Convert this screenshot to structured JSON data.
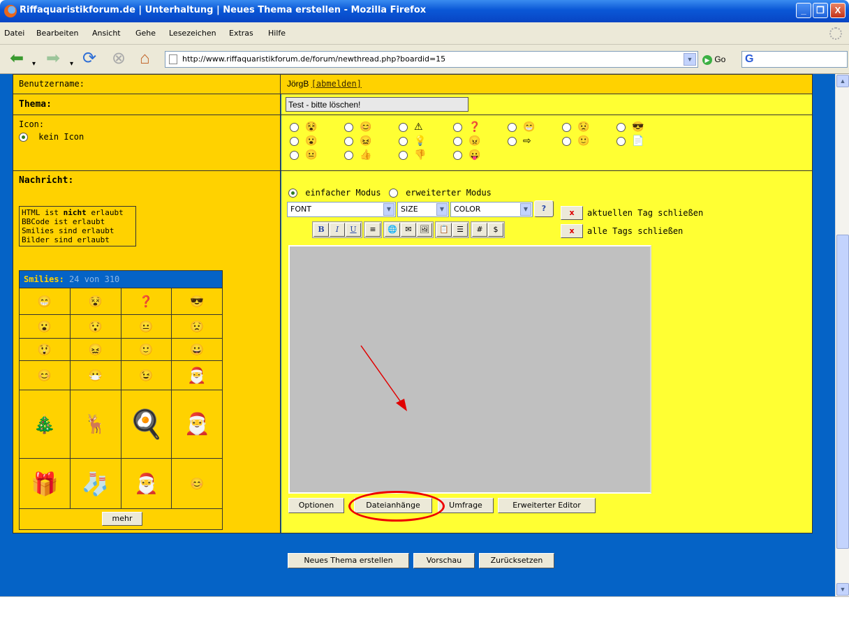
{
  "window": {
    "title": "Riffaquaristikforum.de | Unterhaltung | Neues Thema erstellen - Mozilla Firefox",
    "minimize": "_",
    "maximize": "❐",
    "close": "X"
  },
  "menu": {
    "items": [
      "Datei",
      "Bearbeiten",
      "Ansicht",
      "Gehe",
      "Lesezeichen",
      "Extras",
      "Hilfe"
    ]
  },
  "nav": {
    "url": "http://www.riffaquaristikforum.de/forum/newthread.php?boardid=15",
    "go_label": "Go",
    "icons": [
      "back-icon",
      "forward-icon",
      "reload-icon",
      "stop-icon",
      "home-icon"
    ]
  },
  "form": {
    "username_label": "Benutzername:",
    "username_value": "JörgB",
    "logout_link": "[abmelden]",
    "thema_label": "Thema:",
    "thema_value": "Test - bitte löschen!",
    "icon_label": "Icon:",
    "no_icon_label": "kein Icon",
    "message_label": "Nachricht:",
    "rules": {
      "html_prefix": "HTML ist ",
      "html_bold": "nicht",
      "html_suffix": " erlaubt",
      "bbcode": "BBCode ist erlaubt",
      "smilies": "Smilies sind erlaubt",
      "images": "Bilder sind erlaubt"
    }
  },
  "smilies": {
    "title": "Smilies:",
    "count": "24 von 310",
    "more_button": "mehr",
    "rows": [
      [
        "😁",
        "😵",
        "❓",
        "😎"
      ],
      [
        "😮",
        "😯",
        "😐",
        "😟"
      ],
      [
        "😲",
        "😖",
        "🙂",
        "😀"
      ],
      [
        "😊",
        "😷",
        "😉",
        "🎅"
      ],
      [
        "🎄",
        "🦌",
        "🍳",
        "🎅"
      ],
      [
        "🎁",
        "🧦",
        "🎅",
        "😊"
      ]
    ]
  },
  "editor": {
    "mode_simple": "einfacher Modus",
    "mode_advanced": "erweiterter Modus",
    "font_select": "FONT",
    "size_select": "SIZE",
    "color_select": "COLOR",
    "help_button": "?",
    "close_tag": "aktuellen Tag schließen",
    "close_all_tags": "alle Tags schließen",
    "close_x": "x",
    "toolbar": [
      "B",
      "I",
      "U",
      "≡",
      "🌐",
      "✉",
      "🖼",
      "📋",
      "☰",
      "#",
      "$"
    ],
    "buttons": {
      "options": "Optionen",
      "attachments": "Dateianhänge",
      "poll": "Umfrage",
      "advanced_editor": "Erweiterter Editor"
    }
  },
  "actions": {
    "submit": "Neues Thema erstellen",
    "preview": "Vorschau",
    "reset": "Zurücksetzen"
  },
  "colors": {
    "accent_blue": "#0563c6",
    "label_yellow": "#ffd200",
    "value_yellow": "#ffff33",
    "annotation_red": "#e00000"
  }
}
